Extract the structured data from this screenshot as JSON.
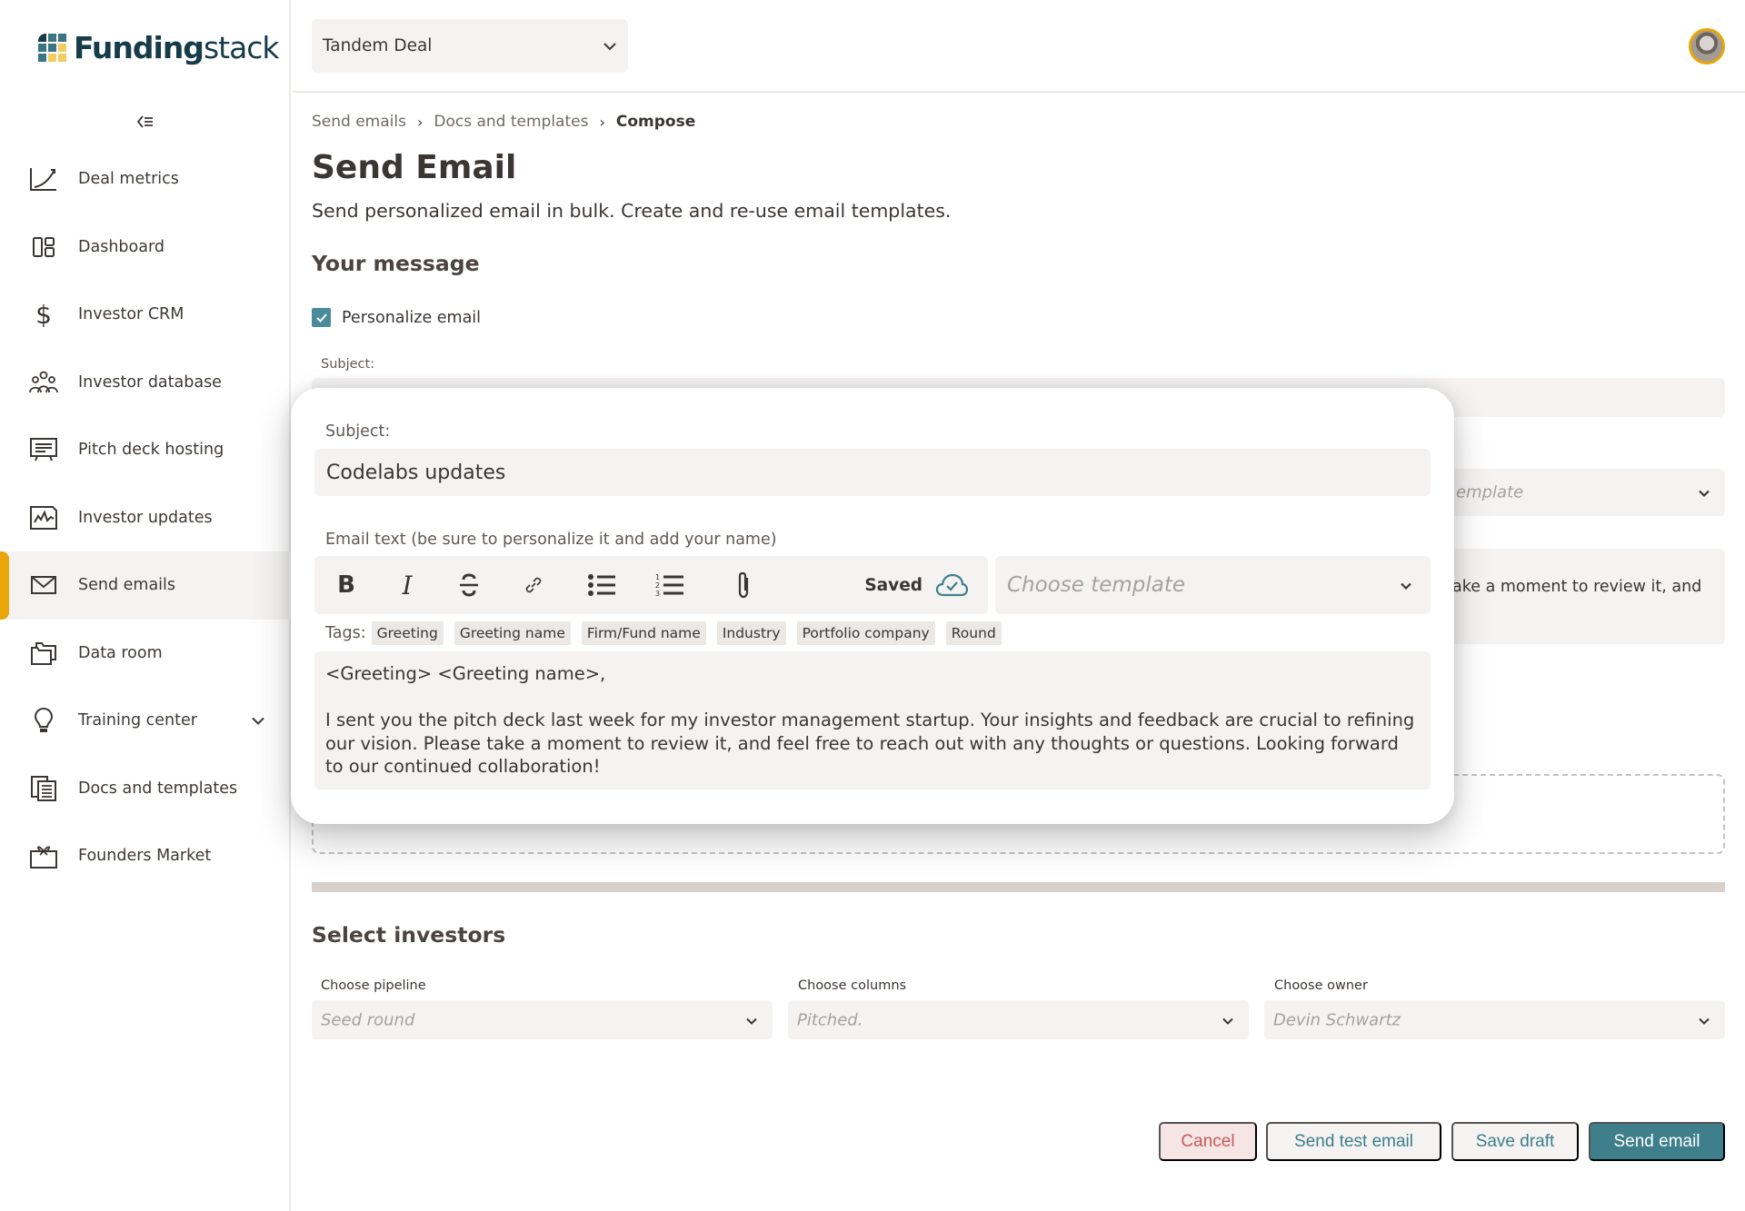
{
  "brand": {
    "name_bold": "Funding",
    "name_light": "stack",
    "logo_colors": [
      "#163b49",
      "#3a7584",
      "#3a7584",
      "#3a7584",
      "#3a7584",
      "#f3cd5f",
      "#3a7584",
      "#f3cd5f",
      "#f3cd5f"
    ]
  },
  "sidebar": {
    "collapse_icon": "collapse-left-icon",
    "items": [
      {
        "label": "Deal metrics",
        "icon": "chart-trend-icon",
        "active": false
      },
      {
        "label": "Dashboard",
        "icon": "dashboard-icon",
        "active": false
      },
      {
        "label": "Investor CRM",
        "icon": "dollar-icon",
        "active": false
      },
      {
        "label": "Investor database",
        "icon": "people-icon",
        "active": false
      },
      {
        "label": "Pitch deck hosting",
        "icon": "presentation-icon",
        "active": false
      },
      {
        "label": "Investor updates",
        "icon": "report-chart-icon",
        "active": false
      },
      {
        "label": "Send emails",
        "icon": "mail-icon",
        "active": true
      },
      {
        "label": "Data room",
        "icon": "folders-icon",
        "active": false
      },
      {
        "label": "Training center",
        "icon": "lightbulb-icon",
        "active": false,
        "expandable": true
      },
      {
        "label": "Docs and templates",
        "icon": "documents-icon",
        "active": false
      },
      {
        "label": "Founders Market",
        "icon": "gift-icon",
        "active": false
      }
    ]
  },
  "header": {
    "deal_select": "Tandem Deal",
    "avatar_alt": "user-avatar"
  },
  "breadcrumb": [
    "Send emails",
    "Docs and templates",
    "Compose"
  ],
  "page": {
    "title": "Send Email",
    "description": "Send personalized email in bulk. Create and re-use email templates.",
    "your_message": "Your message",
    "personalize_label": "Personalize email",
    "personalize_checked": true,
    "subject_label": "Subject:",
    "bg_template_placeholder": "emplate",
    "bg_body_fragment": "ake a moment to review it, and"
  },
  "modal": {
    "subject_label": "Subject:",
    "subject_value": "Codelabs updates",
    "email_text_label": "Email text (be sure to personalize it and add your name)",
    "toolbar": {
      "bold": "B",
      "italic": "I",
      "saved_label": "Saved"
    },
    "template_placeholder": "Choose template",
    "tags_label": "Tags:",
    "tags": [
      "Greeting",
      "Greeting name",
      "Firm/Fund name",
      "Industry",
      "Portfolio company",
      "Round"
    ],
    "body": "<Greeting> <Greeting name>,\n\nI sent you the pitch deck last week for my investor management startup. Your insights and feedback are crucial to refining our vision. Please take a moment to review it, and feel free to reach out with any thoughts or questions. Looking forward to our continued collaboration!"
  },
  "investors": {
    "title": "Select investors",
    "pipeline_label": "Choose pipeline",
    "pipeline_value": "Seed round",
    "columns_label": "Choose columns",
    "columns_value": "Pitched.",
    "owner_label": "Choose owner",
    "owner_value": "Devin Schwartz"
  },
  "actions": {
    "cancel": "Cancel",
    "send_test": "Send test email",
    "save_draft": "Save draft",
    "send": "Send email"
  },
  "colors": {
    "accent": "#3e7f8b",
    "active_marker": "#e8a608",
    "cancel_text": "#c85a5a",
    "field_bg": "#f4f3f2"
  }
}
